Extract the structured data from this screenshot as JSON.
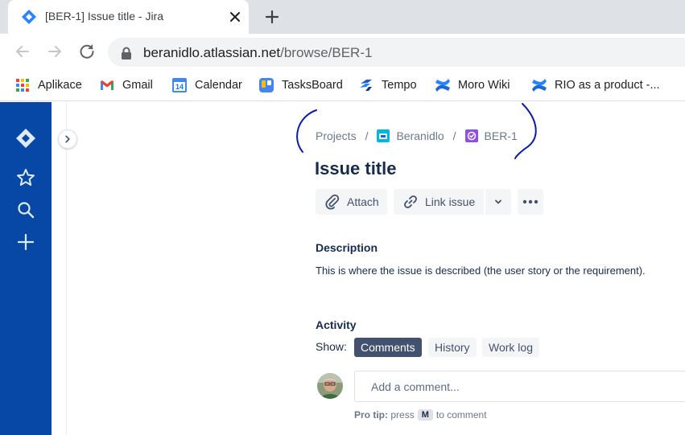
{
  "browser": {
    "tab_title": "[BER-1] Issue title - Jira",
    "url_host": "beranidlo.atlassian.net",
    "url_path": "/browse/BER-1",
    "bookmarks": [
      {
        "label": "Aplikace",
        "icon": "apps-grid-icon"
      },
      {
        "label": "Gmail",
        "icon": "gmail-icon"
      },
      {
        "label": "Calendar",
        "icon": "calendar-icon",
        "badge": "14"
      },
      {
        "label": "TasksBoard",
        "icon": "tasksboard-icon"
      },
      {
        "label": "Tempo",
        "icon": "tempo-icon"
      },
      {
        "label": "Moro Wiki",
        "icon": "confluence-icon"
      },
      {
        "label": "RIO as a product -...",
        "icon": "confluence-icon"
      }
    ]
  },
  "sidebar": {
    "icons": [
      "jira-logo-icon",
      "star-icon",
      "search-icon",
      "plus-icon"
    ]
  },
  "breadcrumbs": {
    "projects": "Projects",
    "project": "Beranidlo",
    "issue_key": "BER-1",
    "separator": "/"
  },
  "issue": {
    "title": "Issue title",
    "actions": {
      "attach": "Attach",
      "link_issue": "Link issue"
    },
    "description_heading": "Description",
    "description_text": "This is where the issue is described (the user story or the requirement)."
  },
  "activity": {
    "heading": "Activity",
    "show_label": "Show:",
    "filters": [
      "Comments",
      "History",
      "Work log"
    ],
    "active_filter": "Comments",
    "comment_placeholder": "Add a comment...",
    "protip_prefix": "Pro tip:",
    "protip_press": "press",
    "protip_key": "M",
    "protip_suffix": "to comment"
  },
  "colors": {
    "sidebar": "#0747a6",
    "text_primary": "#172b4d",
    "active_filter_bg": "#42526e",
    "annotation": "#0a1fa8"
  }
}
